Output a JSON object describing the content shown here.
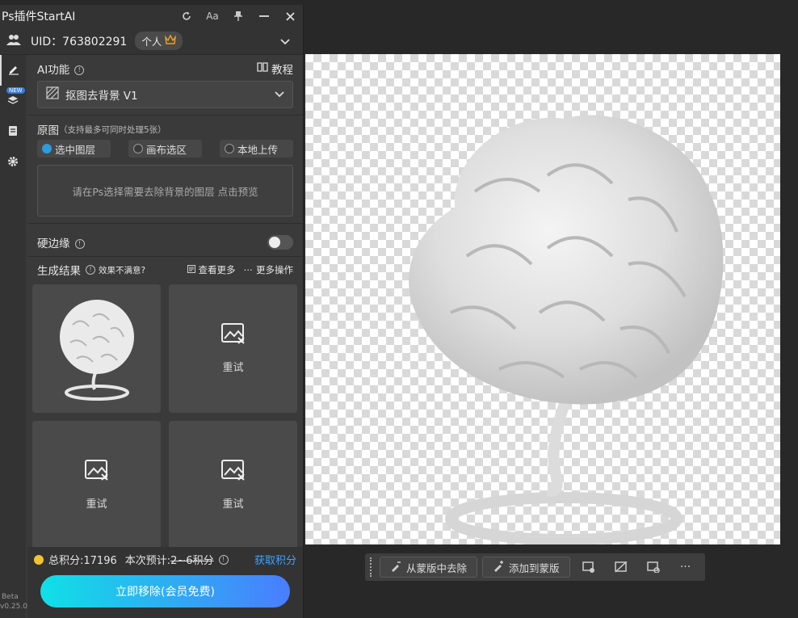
{
  "panel": {
    "title": "Ps插件StartAI",
    "controls": {
      "refresh": "refresh-icon",
      "font": "Aa",
      "pin": "pin-icon",
      "minimize": "minimize-icon",
      "close": "close-icon"
    },
    "user": {
      "uid": "UID：763802291",
      "plan": "个人"
    },
    "sidebar": {
      "beta": "Beta",
      "version": "v0.25.0",
      "new_badge": "NEW"
    },
    "ai_feature": {
      "label": "AI功能",
      "tutorial": "教程",
      "selected": "抠图去背景 V1"
    },
    "source": {
      "label": "原图",
      "note": "（支持最多可同时处理5张）",
      "options": [
        {
          "label": "选中图层",
          "selected": true
        },
        {
          "label": "画布选区",
          "selected": false
        },
        {
          "label": "本地上传",
          "selected": false
        }
      ],
      "hint": "请在Ps选择需要去除背景的图层 点击预览"
    },
    "hard_edge": {
      "label": "硬边缘",
      "enabled": false
    },
    "results": {
      "label": "生成结果",
      "unsatisfied": "效果不满意?",
      "view_more": "查看更多",
      "more_actions": "更多操作",
      "retry": "重试"
    },
    "footer": {
      "total_label": "总积分:17196",
      "estimate_label": "本次预计:",
      "estimate_value": "2~6积分",
      "get_points": "获取积分",
      "cta": "立即移除(会员免费)"
    }
  },
  "mask_toolbar": {
    "remove": "从蒙版中去除",
    "add": "添加到蒙版",
    "more": "···"
  },
  "colors": {
    "accent": "#2d9cdb",
    "cta_start": "#10e0e6",
    "cta_end": "#4a7dff",
    "link": "#3ea3ff"
  }
}
